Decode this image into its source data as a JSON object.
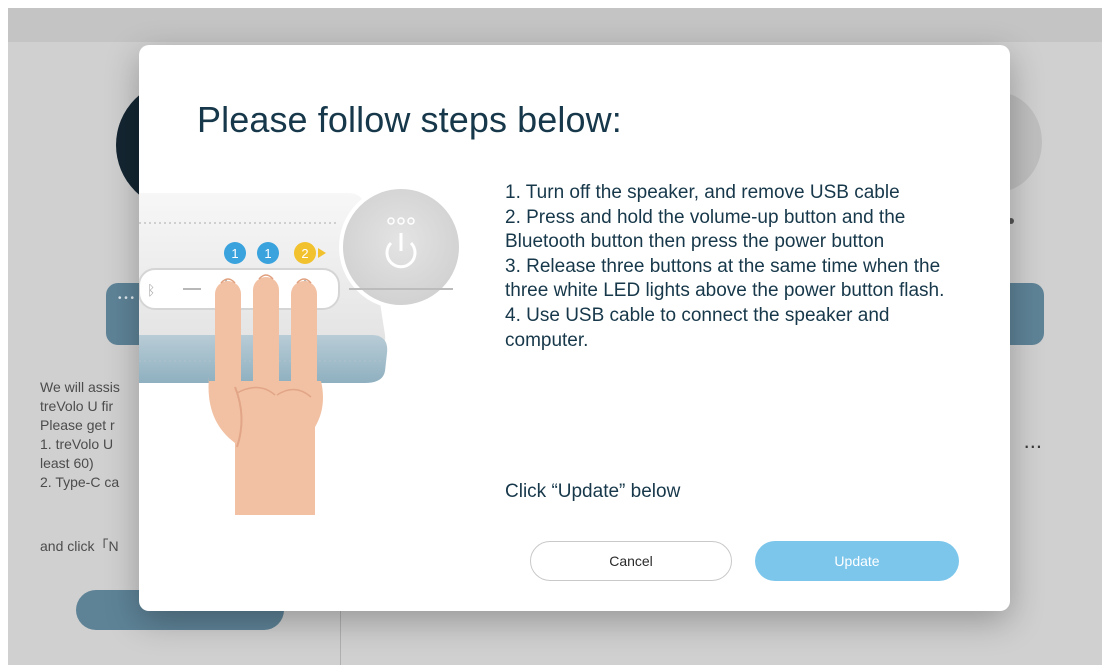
{
  "background": {
    "intro_lines": "We will assis\ntreVolo U fir\nPlease get r\n1. treVolo U \nleast 60)\n2. Type-C ca",
    "footer_text": "and click「N",
    "ellipsis": "..."
  },
  "modal": {
    "title": "Please follow steps below:",
    "steps": [
      "1. Turn off the speaker, and remove USB cable",
      "2. Press and hold the volume-up button and the Bluetooth button then press the power button",
      "3. Release three buttons at the same time when the three white LED lights above the power button flash.",
      "4. Use USB cable to connect the speaker and computer."
    ],
    "click_hint": "Click “Update” below",
    "cancel_label": "Cancel",
    "update_label": "Update"
  },
  "illustration": {
    "badges": [
      "1",
      "1",
      "2"
    ]
  },
  "colors": {
    "accent": "#7cc6ec",
    "title_text": "#17384a",
    "badge_blue": "#3aa3dd",
    "badge_yellow": "#f2c12e",
    "background_band": "#5e8397"
  }
}
